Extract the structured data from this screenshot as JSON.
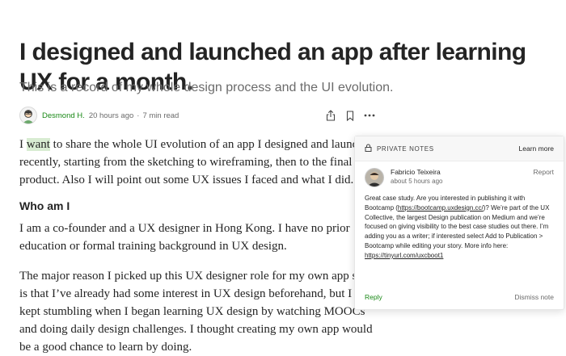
{
  "article": {
    "title": "I designed and launched an app after learning UX for a month.",
    "subtitle": "This is a record of my whole design process and the UI evolution.",
    "byline": {
      "author": "Desmond H.",
      "posted": "20 hours ago",
      "separator": "·",
      "read_time": "7 min read"
    },
    "p1": {
      "start": "I ",
      "highlight": "want",
      "rest": " to share the whole UI evolution of an app I designed and launched recently, starting from the sketching to wireframing, then to the final product. Also I will point out some UX issues I faced and what I did."
    },
    "heading": "Who am I",
    "p2": "I am a co-founder and a UX designer in Hong Kong. I have no prior education or formal training background in UX design.",
    "p3": "The major reason I picked up this UX designer role for my own app start is that I’ve already had some interest in UX design beforehand, but I kept stumbling when I began learning UX design by watching MOOCs and doing daily design challenges. I thought creating my own app would be a good chance to learn by doing."
  },
  "notes": {
    "header_label": "PRIVATE NOTES",
    "learn_more": "Learn more",
    "author": "Fabricio Teixeira",
    "time": "about 5 hours ago",
    "report": "Report",
    "body_1": "Great case study. Are you interested in publishing it with Bootcamp (",
    "link_1": "https://bootcamp.uxdesign.cc/",
    "body_2": ")? We’re part of the UX Collective, the largest Design publication on Medium and we’re focused on giving visibility to the best case studies out there. I’m adding you as a writer; if interested select Add to Publication > Bootcamp while editing your story. More info here: ",
    "link_2": "https://tinyurl.com/uxcboot1",
    "reply": "Reply",
    "dismiss": "Dismiss note"
  },
  "icons": {
    "share": "share-icon",
    "bookmark": "bookmark-icon",
    "more": "more-icon",
    "lock": "lock-icon"
  },
  "colors": {
    "accent_green": "#1a8917",
    "highlight": "#d8ecd2",
    "text": "#242424",
    "muted": "#6b6b6b"
  }
}
